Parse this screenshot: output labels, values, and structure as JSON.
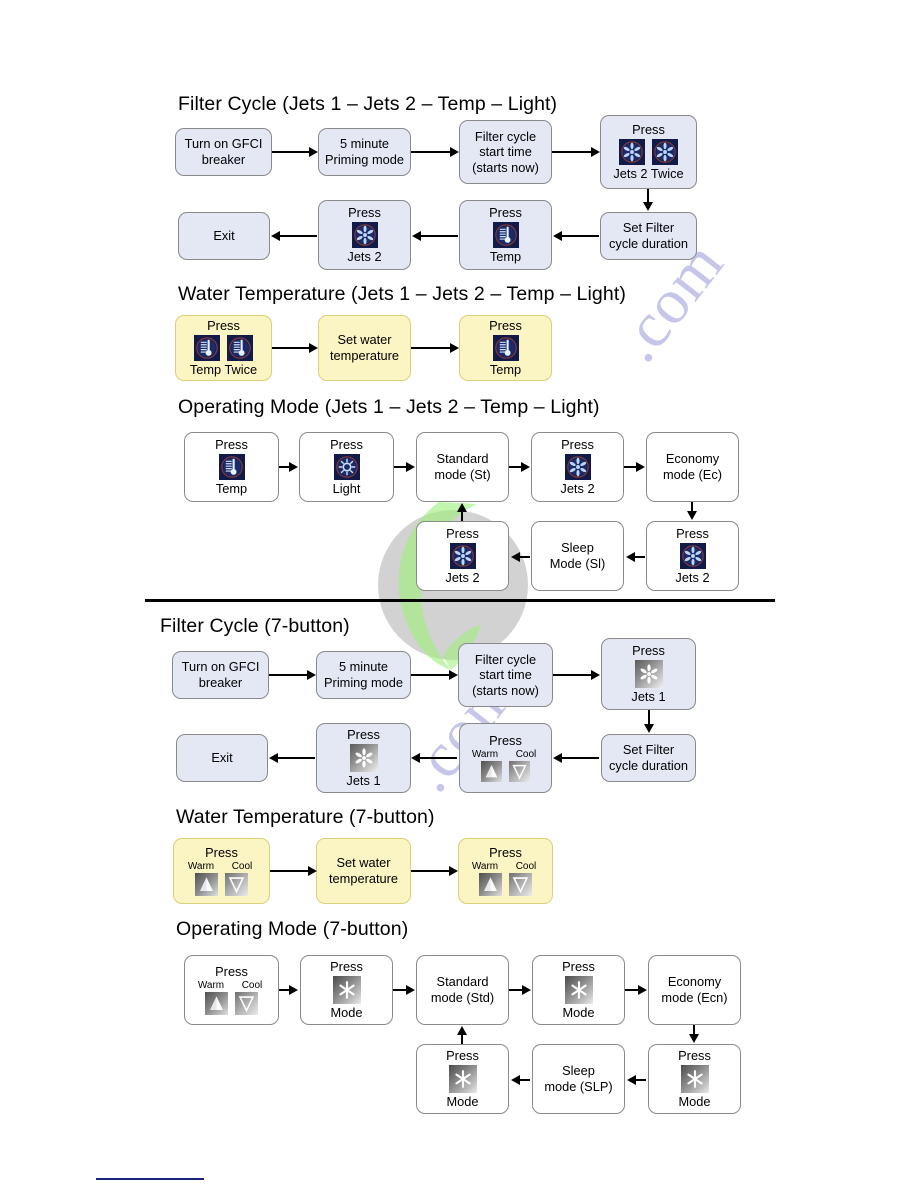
{
  "document": {
    "watermark_text": ".com",
    "colors": {
      "box_blue_fill": "#e3e8f4",
      "box_yellow_fill": "#fbf5c4",
      "box_white_fill": "#ffffff",
      "box_border": "#8a8a8a",
      "icon_dark_navy": "#121a4a",
      "divider": "#000000",
      "footer_rule": "#1a237e"
    }
  },
  "sections": [
    {
      "id": "filter-cycle-4button",
      "heading": "Filter Cycle (Jets 1 – Jets 2 – Temp – Light)",
      "style": "blue",
      "nodes": [
        {
          "id": "n1",
          "lines": [
            "Turn on GFCI",
            "breaker"
          ]
        },
        {
          "id": "n2",
          "lines": [
            "5 minute",
            "Priming mode"
          ]
        },
        {
          "id": "n3",
          "lines": [
            "Filter cycle",
            "start time",
            "(starts now)"
          ]
        },
        {
          "id": "n4",
          "title": "Press",
          "caption": "Jets 2 Twice",
          "icons": [
            "jets-icon",
            "jets-icon"
          ]
        },
        {
          "id": "n5",
          "lines": [
            "Set Filter",
            "cycle duration"
          ]
        },
        {
          "id": "n6",
          "title": "Press",
          "caption": "Temp",
          "icons": [
            "temp-icon"
          ]
        },
        {
          "id": "n7",
          "title": "Press",
          "caption": "Jets 2",
          "icons": [
            "jets-icon"
          ]
        },
        {
          "id": "n8",
          "lines": [
            "Exit"
          ]
        }
      ]
    },
    {
      "id": "water-temperature-4button",
      "heading": "Water Temperature (Jets 1 – Jets 2 – Temp – Light)",
      "style": "yellow",
      "nodes": [
        {
          "id": "w1",
          "title": "Press",
          "caption": "Temp Twice",
          "icons": [
            "temp-icon",
            "temp-icon"
          ]
        },
        {
          "id": "w2",
          "lines": [
            "Set water",
            "temperature"
          ]
        },
        {
          "id": "w3",
          "title": "Press",
          "caption": "Temp",
          "icons": [
            "temp-icon"
          ]
        }
      ]
    },
    {
      "id": "operating-mode-4button",
      "heading": "Operating Mode (Jets 1 – Jets 2 – Temp – Light)",
      "style": "white",
      "nodes": [
        {
          "id": "o1",
          "title": "Press",
          "caption": "Temp",
          "icons": [
            "temp-icon"
          ]
        },
        {
          "id": "o2",
          "title": "Press",
          "caption": "Light",
          "icons": [
            "light-icon"
          ]
        },
        {
          "id": "o3",
          "lines": [
            "Standard",
            "mode (St)"
          ]
        },
        {
          "id": "o4",
          "title": "Press",
          "caption": "Jets 2",
          "icons": [
            "jets-icon"
          ]
        },
        {
          "id": "o5",
          "lines": [
            "Economy",
            "mode (Ec)"
          ]
        },
        {
          "id": "o6",
          "title": "Press",
          "caption": "Jets 2",
          "icons": [
            "jets-icon"
          ]
        },
        {
          "id": "o7",
          "lines": [
            "Sleep",
            "Mode (Sl)"
          ]
        },
        {
          "id": "o8",
          "title": "Press",
          "caption": "Jets 2",
          "icons": [
            "jets-icon"
          ]
        }
      ]
    },
    {
      "id": "filter-cycle-7button",
      "heading": "Filter Cycle (7-button)",
      "style": "blue",
      "nodes": [
        {
          "id": "f1",
          "lines": [
            "Turn on GFCI",
            "breaker"
          ]
        },
        {
          "id": "f2",
          "lines": [
            "5 minute",
            "Priming mode"
          ]
        },
        {
          "id": "f3",
          "lines": [
            "Filter cycle",
            "start time",
            "(starts now)"
          ]
        },
        {
          "id": "f4",
          "title": "Press",
          "caption": "Jets 1",
          "icons": [
            "jets1-icon"
          ]
        },
        {
          "id": "f5",
          "lines": [
            "Set Filter",
            "cycle duration"
          ]
        },
        {
          "id": "f6",
          "title": "Press",
          "warm_label": "Warm",
          "cool_label": "Cool",
          "icons": [
            "warm-icon",
            "cool-icon"
          ]
        },
        {
          "id": "f7",
          "title": "Press",
          "caption": "Jets 1",
          "icons": [
            "jets1-icon"
          ]
        },
        {
          "id": "f8",
          "lines": [
            "Exit"
          ]
        }
      ]
    },
    {
      "id": "water-temperature-7button",
      "heading": "Water Temperature (7-button)",
      "style": "yellow",
      "nodes": [
        {
          "id": "y1",
          "title": "Press",
          "warm_label": "Warm",
          "cool_label": "Cool",
          "icons": [
            "warm-icon",
            "cool-icon"
          ]
        },
        {
          "id": "y2",
          "lines": [
            "Set water",
            "temperature"
          ]
        },
        {
          "id": "y3",
          "title": "Press",
          "warm_label": "Warm",
          "cool_label": "Cool",
          "icons": [
            "warm-icon",
            "cool-icon"
          ]
        }
      ]
    },
    {
      "id": "operating-mode-7button",
      "heading": "Operating Mode (7-button)",
      "style": "white",
      "nodes": [
        {
          "id": "m1",
          "title": "Press",
          "warm_label": "Warm",
          "cool_label": "Cool",
          "icons": [
            "warm-icon",
            "cool-icon"
          ]
        },
        {
          "id": "m2",
          "title": "Press",
          "caption": "Mode",
          "icons": [
            "mode-icon"
          ]
        },
        {
          "id": "m3",
          "lines": [
            "Standard",
            "mode (Std)"
          ]
        },
        {
          "id": "m4",
          "title": "Press",
          "caption": "Mode",
          "icons": [
            "mode-icon"
          ]
        },
        {
          "id": "m5",
          "lines": [
            "Economy",
            "mode (Ecn)"
          ]
        },
        {
          "id": "m6",
          "title": "Press",
          "caption": "Mode",
          "icons": [
            "mode-icon"
          ]
        },
        {
          "id": "m7",
          "lines": [
            "Sleep",
            "mode (SLP)"
          ]
        },
        {
          "id": "m8",
          "title": "Press",
          "caption": "Mode",
          "icons": [
            "mode-icon"
          ]
        }
      ]
    }
  ]
}
